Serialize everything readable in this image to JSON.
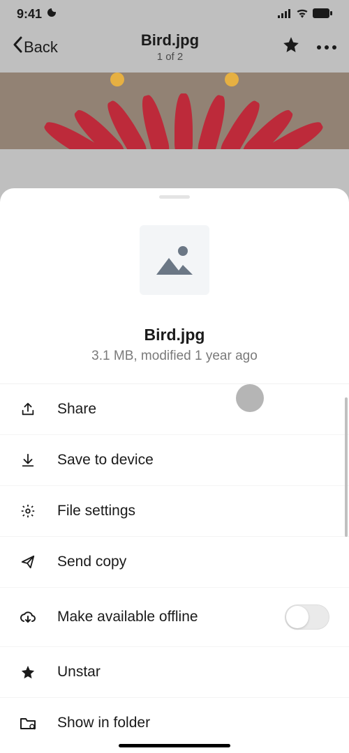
{
  "status": {
    "time": "9:41",
    "signal": "●●●●",
    "wifi": "wifi",
    "battery": "full"
  },
  "nav": {
    "back_label": "Back",
    "title": "Bird.jpg",
    "subtitle": "1 of 2"
  },
  "sheet": {
    "filename": "Bird.jpg",
    "meta": "3.1 MB, modified 1 year ago"
  },
  "menu": {
    "share": "Share",
    "save": "Save to device",
    "settings": "File settings",
    "send": "Send copy",
    "offline": "Make available offline",
    "offline_on": false,
    "unstar": "Unstar",
    "show": "Show in folder"
  }
}
